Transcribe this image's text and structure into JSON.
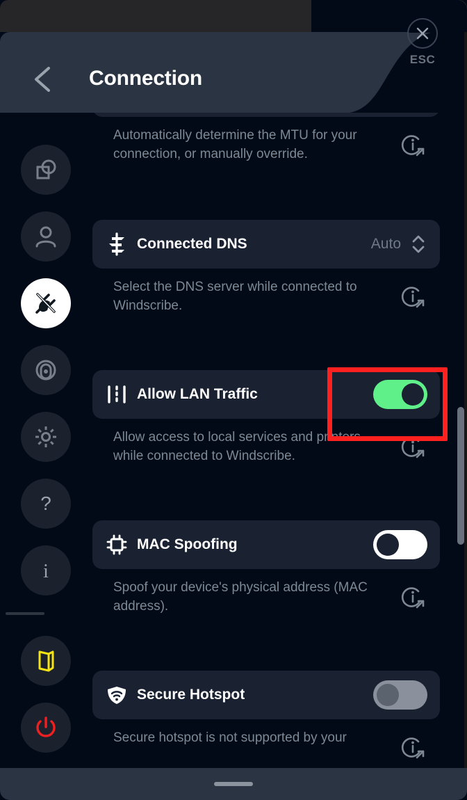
{
  "window": {
    "title_bar": {
      "name": "title-bar"
    },
    "bottom_bar": {
      "handle": "drag-handle"
    }
  },
  "header": {
    "title": "Connection",
    "back_icon": "chevron-left-icon",
    "close_icon": "close-icon",
    "esc_label": "ESC"
  },
  "sidebar": {
    "items": [
      {
        "icon": "general-overlap-icon",
        "name": "sidebar-item-general",
        "active": false
      },
      {
        "icon": "account-person-icon",
        "name": "sidebar-item-account",
        "active": false
      },
      {
        "icon": "connection-plug-icon",
        "name": "sidebar-item-connection",
        "active": true
      },
      {
        "icon": "robert-target-icon",
        "name": "sidebar-item-robert",
        "active": false
      },
      {
        "icon": "gear-icon",
        "name": "sidebar-item-advanced",
        "active": false
      },
      {
        "icon": "question-mark-icon",
        "name": "sidebar-item-help",
        "active": false
      },
      {
        "icon": "info-letter-icon",
        "name": "sidebar-item-about",
        "active": false
      },
      {
        "icon": "exit-door-icon",
        "name": "sidebar-item-logout",
        "active": false
      },
      {
        "icon": "power-icon",
        "name": "sidebar-item-quit",
        "active": false
      }
    ]
  },
  "settings": {
    "mtu": {
      "description": "Automatically determine the MTU for your connection, or manually override.",
      "info_icon": "info-external-link-icon"
    },
    "connected_dns": {
      "title": "Connected DNS",
      "icon": "signpost-dns-icon",
      "value": "Auto",
      "stepper_icon": "chevron-up-down-icon",
      "description": "Select the DNS server while connected to Windscribe.",
      "info_icon": "info-external-link-icon"
    },
    "allow_lan_traffic": {
      "title": "Allow LAN Traffic",
      "icon": "lan-lines-icon",
      "toggle_state": "on",
      "description": "Allow access to local services and printers while connected to Windscribe.",
      "info_icon": "info-external-link-icon"
    },
    "mac_spoofing": {
      "title": "MAC Spoofing",
      "icon": "cpu-chip-icon",
      "toggle_state": "off",
      "description": "Spoof your device's physical address (MAC address).",
      "info_icon": "info-external-link-icon"
    },
    "secure_hotspot": {
      "title": "Secure Hotspot",
      "icon": "shield-wifi-icon",
      "toggle_state": "disabled",
      "description": "Secure hotspot is not supported by your",
      "info_icon": "info-external-link-icon"
    }
  },
  "colors": {
    "accent_green": "#60f08a",
    "highlight_red": "#ff2020",
    "logout_yellow": "#f5e414",
    "power_red": "#f02020",
    "background": "#020a18",
    "card": "#1a2232",
    "header_panel": "#2b3442"
  },
  "annotation": {
    "highlight_target": "allow-lan-traffic-toggle"
  }
}
